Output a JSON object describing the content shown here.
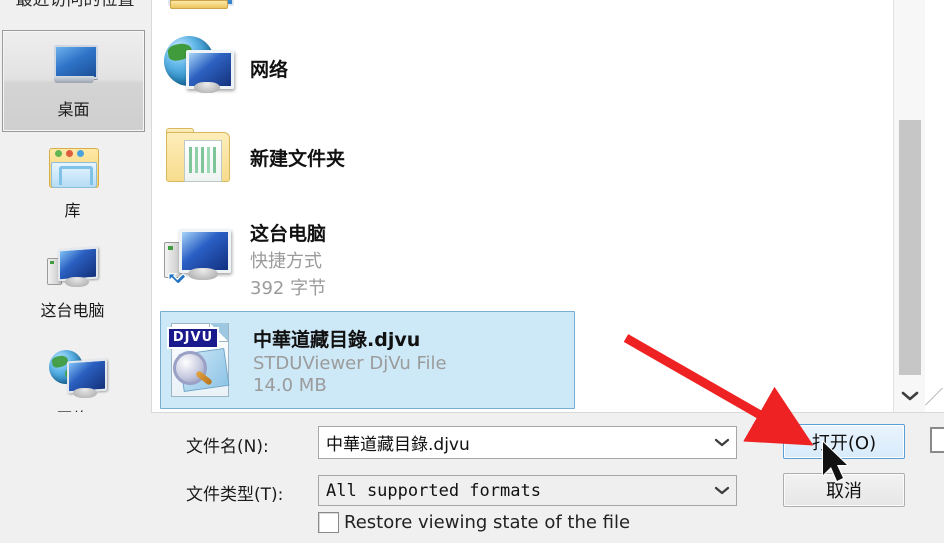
{
  "dialog": {
    "title_fragment_clipped": "最近访问的位置"
  },
  "places_bar": {
    "items": [
      {
        "label": "最近访问的位置",
        "icon": "recent-places-icon",
        "selected": false,
        "clipped": true
      },
      {
        "label": "桌面",
        "icon": "desktop-monitor-icon",
        "selected": true
      },
      {
        "label": "库",
        "icon": "library-folder-icon",
        "selected": false
      },
      {
        "label": "这台电脑",
        "icon": "this-pc-icon",
        "selected": false
      },
      {
        "label": "网络",
        "icon": "network-globe-icon",
        "selected": false
      }
    ]
  },
  "file_list": {
    "items": [
      {
        "name": "",
        "icon": "homegroup-icon",
        "subtitle": "",
        "size": "",
        "selected": false,
        "clipped": true
      },
      {
        "name": "网络",
        "icon": "network-globe-icon",
        "subtitle": "",
        "size": "",
        "selected": false
      },
      {
        "name": "新建文件夹",
        "icon": "folder-icon",
        "subtitle": "",
        "size": "",
        "selected": false
      },
      {
        "name": "这台电脑",
        "icon": "shortcut-pc-icon",
        "subtitle": "快捷方式",
        "size": "392 字节",
        "selected": false
      },
      {
        "name": "中華道藏目錄.djvu",
        "icon": "djvu-file-icon",
        "subtitle": "STDUViewer DjVu File",
        "size": "14.0 MB",
        "selected": true
      }
    ],
    "scrollbar": {
      "orientation": "vertical",
      "arrow_down_glyph": "⌄"
    }
  },
  "form": {
    "file_name_label": "文件名(N):",
    "file_name_value": "中華道藏目錄.djvu",
    "file_type_label": "文件类型(T):",
    "file_type_value": "All supported formats",
    "dropdown_caret_glyph": "⌄",
    "restore_checkbox_label": "Restore viewing state of the file",
    "restore_checkbox_checked": false
  },
  "buttons": {
    "open_label": "打开(O)",
    "cancel_label": "取消"
  },
  "icons": {
    "djvu_tag_text": "DJVU"
  },
  "colors": {
    "selection_fill": "#cde8f7",
    "selection_border": "#7aaed0",
    "default_button_border": "#5b9fd4",
    "annotation_red": "#ee2222",
    "dialog_background": "#f0f0f0",
    "list_background": "#ffffff"
  },
  "annotations": {
    "arrow": {
      "color": "#ee2222",
      "points_to": "open-button"
    },
    "cursor": {
      "type": "arrow-pointer",
      "over": "open-button"
    }
  }
}
